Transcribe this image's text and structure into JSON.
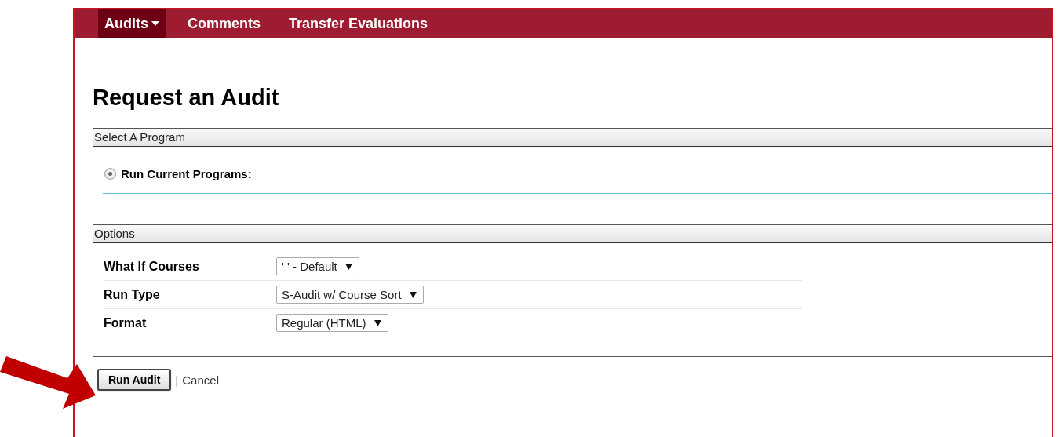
{
  "nav": {
    "tabs": [
      {
        "label": "Audits",
        "selected": true,
        "dropdown": true
      },
      {
        "label": "Comments",
        "selected": false,
        "dropdown": false
      },
      {
        "label": "Transfer Evaluations",
        "selected": false,
        "dropdown": false
      }
    ]
  },
  "page_title": "Request an Audit",
  "program_panel": {
    "legend": "Select A Program",
    "radio": {
      "label": "Run Current Programs:",
      "checked": true
    }
  },
  "options_panel": {
    "legend": "Options",
    "rows": [
      {
        "label": "What If Courses",
        "value": "' ' - Default"
      },
      {
        "label": "Run Type",
        "value": "S-Audit w/ Course Sort"
      },
      {
        "label": "Format",
        "value": "Regular (HTML)"
      }
    ]
  },
  "actions": {
    "submit": "Run Audit",
    "separator": "|",
    "cancel": "Cancel"
  }
}
